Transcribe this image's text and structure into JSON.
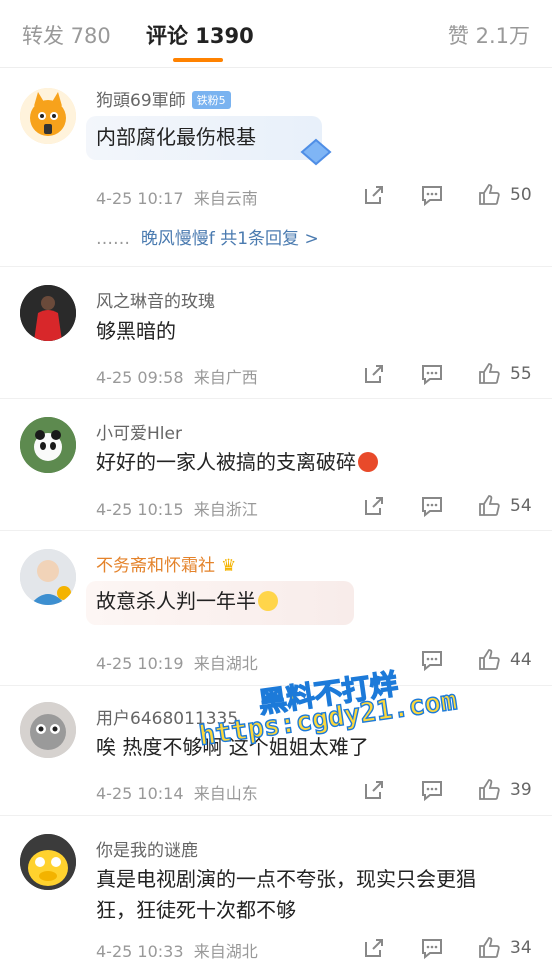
{
  "tabs": {
    "reposts": "转发 780",
    "comments": "评论 1390",
    "likes": "赞 2.1万"
  },
  "comments": [
    {
      "user": "狗頭69軍師",
      "badge": "铁粉5",
      "text": "内部腐化最伤根基",
      "time": "4-25 10:17",
      "source": "来自云南",
      "likes": "50",
      "reply": {
        "prefix": "……",
        "name": "晚风慢慢f",
        "count": "共1条回复",
        "arrow": ">"
      }
    },
    {
      "user": "风之琳音的玫瑰",
      "text": "够黑暗的",
      "time": "4-25 09:58",
      "source": "来自广西",
      "likes": "55"
    },
    {
      "user": "小可爱Hler",
      "text": "好好的一家人被搞的支离破碎",
      "emoji": "angry-face-emoji",
      "time": "4-25 10:15",
      "source": "来自浙江",
      "likes": "54"
    },
    {
      "user": "不务斋和怀霜社",
      "badge_icon": "crown-icon",
      "text": "故意杀人判一年半",
      "emoji": "smirk-face-emoji",
      "time": "4-25 10:19",
      "source": "来自湖北",
      "likes": "44"
    },
    {
      "user": "用户6468011335",
      "text": "唉 热度不够啊 这个姐姐太难了",
      "time": "4-25 10:14",
      "source": "来自山东",
      "likes": "39"
    },
    {
      "user": "你是我的谜鹿",
      "text_line1": "真是电视剧演的一点不夸张，现实只会更猖",
      "text_line2": "狂，狂徒死十次都不够",
      "time": "4-25 10:33",
      "source": "来自湖北",
      "likes": "34"
    }
  ],
  "watermark": {
    "line1": "黑料不打烊",
    "line2": "https:cgdy21.com"
  },
  "colors": {
    "accent": "#ff8200",
    "link": "#4b7bb0",
    "muted": "#999999",
    "text": "#222222",
    "gold_name": "#e4832b"
  },
  "icons": {
    "share": "share-icon",
    "comment": "comment-icon",
    "like": "thumbs-up-icon"
  }
}
